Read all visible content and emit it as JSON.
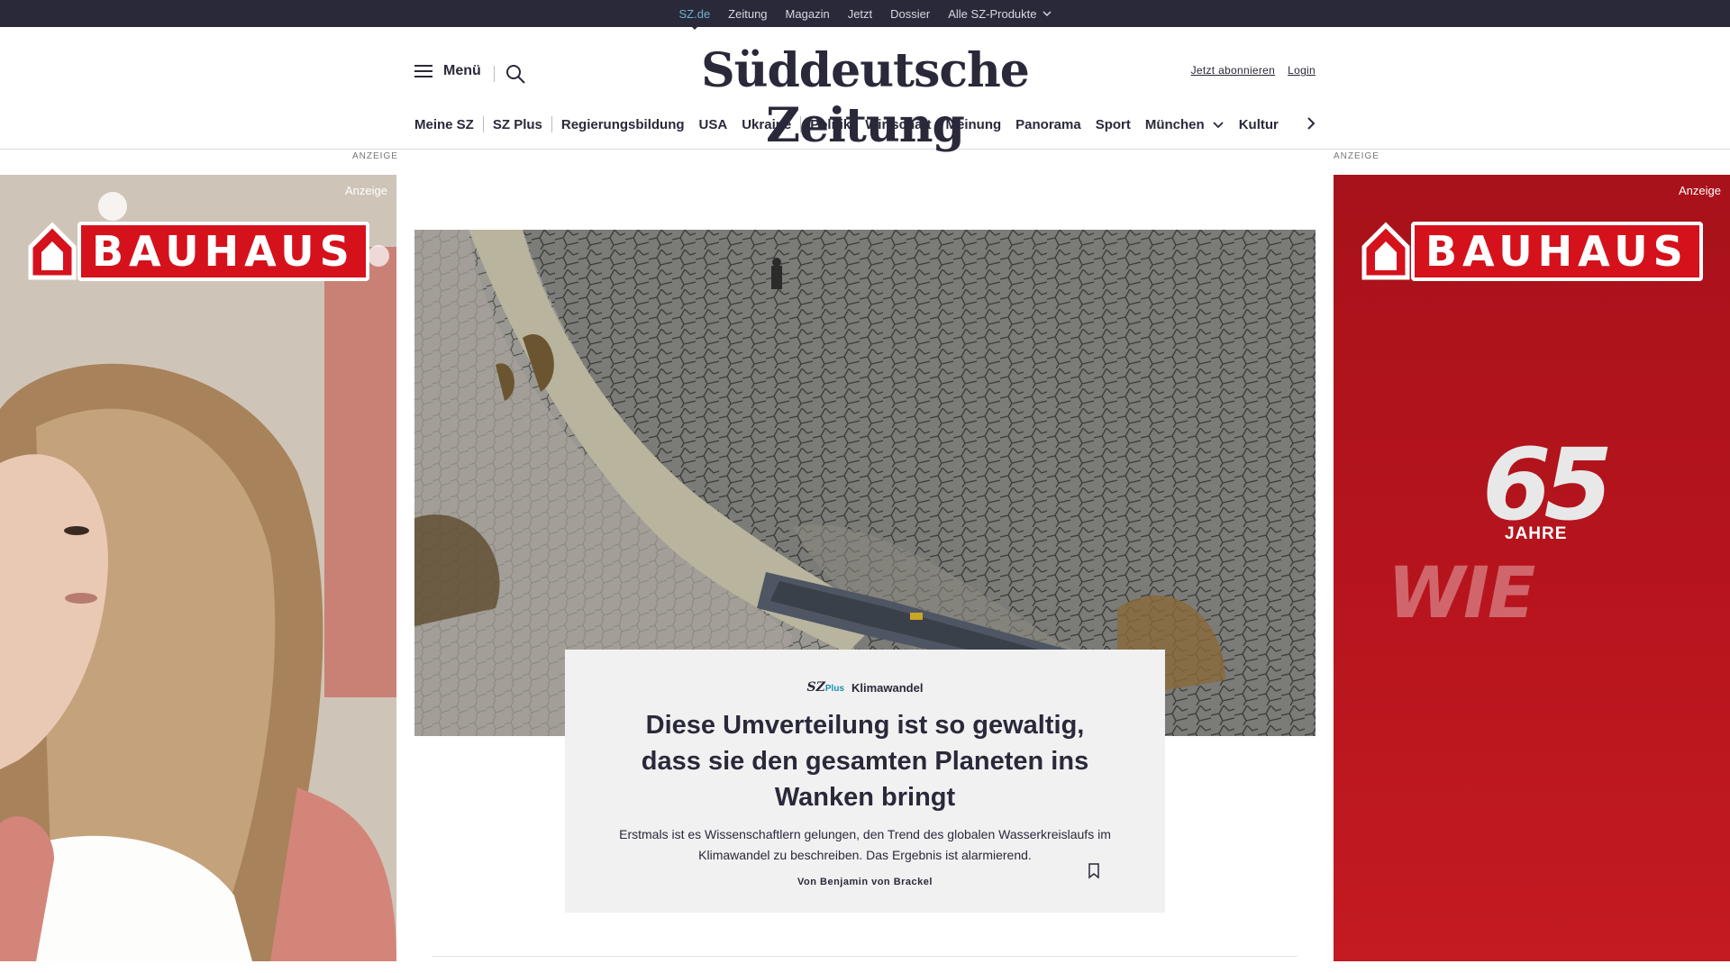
{
  "topbar": {
    "links": [
      "SZ.de",
      "Zeitung",
      "Magazin",
      "Jetzt",
      "Dossier",
      "Alle SZ-Produkte"
    ]
  },
  "header": {
    "menu_label": "Menü",
    "logo": "Süddeutsche Zeitung",
    "subscribe": "Jetzt abonnieren",
    "login": "Login"
  },
  "nav": {
    "items": [
      "Meine SZ",
      "SZ Plus",
      "Regierungsbildung",
      "USA",
      "Ukraine",
      "Politik",
      "Wirtschaft",
      "Meinung",
      "Panorama",
      "Sport",
      "München",
      "Kultur"
    ]
  },
  "ads": {
    "label_left": "ANZEIGE",
    "label_right": "ANZEIGE",
    "tag": "Anzeige",
    "brand": "BAUHAUS",
    "number": "65",
    "jahre": "JAHRE",
    "slogan": "WIE"
  },
  "article": {
    "plus_brand": "SZ",
    "plus_suffix": "Plus",
    "topic": "Klimawandel",
    "headline": "Diese Umverteilung ist so gewaltig, dass sie den gesamten Planeten ins Wanken bringt",
    "teaser": "Erstmals ist es Wissenschaftlern gelungen, den Trend des globalen Wasserkreislaufs im Klimawandel zu beschreiben. Das Ergebnis ist alarmierend.",
    "author": "Von Benjamin von Brackel"
  }
}
